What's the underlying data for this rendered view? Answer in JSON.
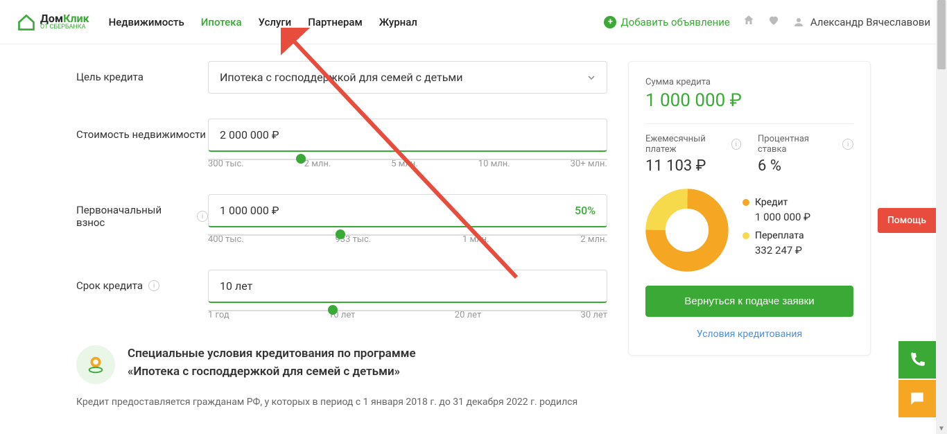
{
  "logo": {
    "title_prefix": "Дом",
    "title_suffix": "Клик",
    "subtitle": "ОТ СБЕРБАНКА"
  },
  "nav": {
    "items": [
      "Недвижимость",
      "Ипотека",
      "Услуги",
      "Партнерам",
      "Журнал"
    ],
    "active_index": 1
  },
  "header_right": {
    "add_label": "Добавить объявление",
    "user_name": "Александр Вячеславови"
  },
  "form": {
    "purpose": {
      "label": "Цель кредита",
      "value": "Ипотека с господдержкой для семей с детьми"
    },
    "cost": {
      "label": "Стоимость недвижимости",
      "value": "2 000 000 ₽",
      "ticks": [
        "300 тыс.",
        "2 млн.",
        "5 млн.",
        "10 млн.",
        "30+ млн."
      ],
      "slider_pct": 22
    },
    "down": {
      "label": "Первоначальный взнос",
      "value": "1 000 000 ₽",
      "pct": "50%",
      "ticks": [
        "400 тыс.",
        "933 тыс.",
        "1 млн.",
        "2 млн."
      ],
      "slider_pct": 32
    },
    "term": {
      "label": "Срок кредита",
      "value": "10 лет",
      "ticks": [
        "1 год",
        "10 лет",
        "20 лет",
        "30 лет"
      ],
      "slider_pct": 30
    }
  },
  "special": {
    "title_line1": "Специальные условия кредитования по программе",
    "title_line2": "«Ипотека с господдержкой для семей с детьми»"
  },
  "credit_description": "Кредит предоставляется гражданам РФ, у которых в период с 1 января 2018 г. до 31 декабря 2022 г. родился",
  "card": {
    "sum_label": "Сумма кредита",
    "sum_value": "1 000 000 ₽",
    "payment_label": "Ежемесячный платеж",
    "payment_value": "11 103 ₽",
    "rate_label": "Процентная ставка",
    "rate_value": "6 %",
    "legend": {
      "credit_label": "Кредит",
      "credit_value": "1 000 000 ₽",
      "over_label": "Переплата",
      "over_value": "332 247 ₽"
    },
    "button": "Вернуться к подаче заявки",
    "terms_link": "Условия кредитования"
  },
  "chart_data": {
    "type": "pie",
    "title": "",
    "series": [
      {
        "name": "Кредит",
        "value": 1000000,
        "color": "#f5a623"
      },
      {
        "name": "Переплата",
        "value": 332247,
        "color": "#f7d94c"
      }
    ]
  },
  "help_label": "Помощь"
}
